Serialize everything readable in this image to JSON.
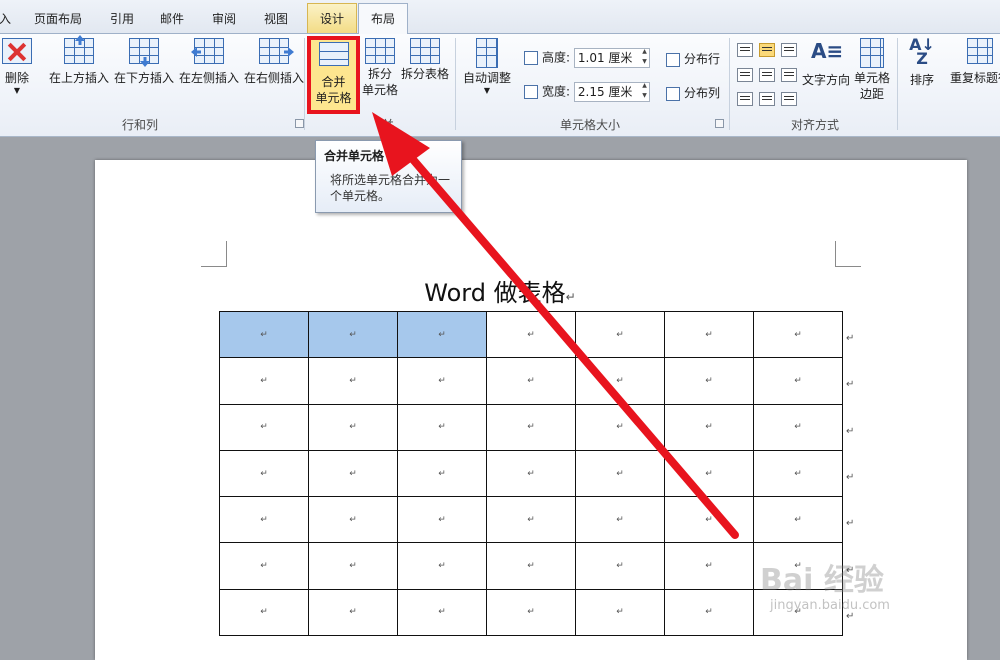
{
  "tabs": [
    {
      "label": "入"
    },
    {
      "label": "页面布局"
    },
    {
      "label": "引用"
    },
    {
      "label": "邮件"
    },
    {
      "label": "审阅"
    },
    {
      "label": "视图"
    },
    {
      "label": "设计"
    },
    {
      "label": "布局"
    }
  ],
  "ribbon": {
    "rows_cols": {
      "delete": "删除",
      "insert_above": "在上方插入",
      "insert_below": "在下方插入",
      "insert_left": "在左侧插入",
      "insert_right": "在右侧插入",
      "group": "行和列"
    },
    "merge": {
      "merge_cells_l1": "合并",
      "merge_cells_l2": "单元格",
      "split_cells_l1": "拆分",
      "split_cells_l2": "单元格",
      "split_table": "拆分表格",
      "group": "并"
    },
    "cell_size": {
      "autofit": "自动调整",
      "height_label": "高度:",
      "height_value": "1.01 厘米",
      "width_label": "宽度:",
      "width_value": "2.15 厘米",
      "distribute_rows": "分布行",
      "distribute_cols": "分布列",
      "group": "单元格大小"
    },
    "alignment": {
      "text_direction": "文字方向",
      "cell_margins_l1": "单元格",
      "cell_margins_l2": "边距",
      "group": "对齐方式"
    },
    "data": {
      "sort": "排序",
      "repeat_header": "重复标题行"
    }
  },
  "tooltip": {
    "title": "合并单元格",
    "desc_l1": "将所选单元格合并为一",
    "desc_l2": "个单元格。"
  },
  "document": {
    "title": "Word 做表格",
    "para_mark": "↵",
    "cell_mark": "↵"
  },
  "watermark": {
    "brand": "Bai 经验",
    "url": "jingyan.baidu.com"
  },
  "colors": {
    "accent_red": "#e8141e",
    "selection": "#a6c8ec"
  }
}
